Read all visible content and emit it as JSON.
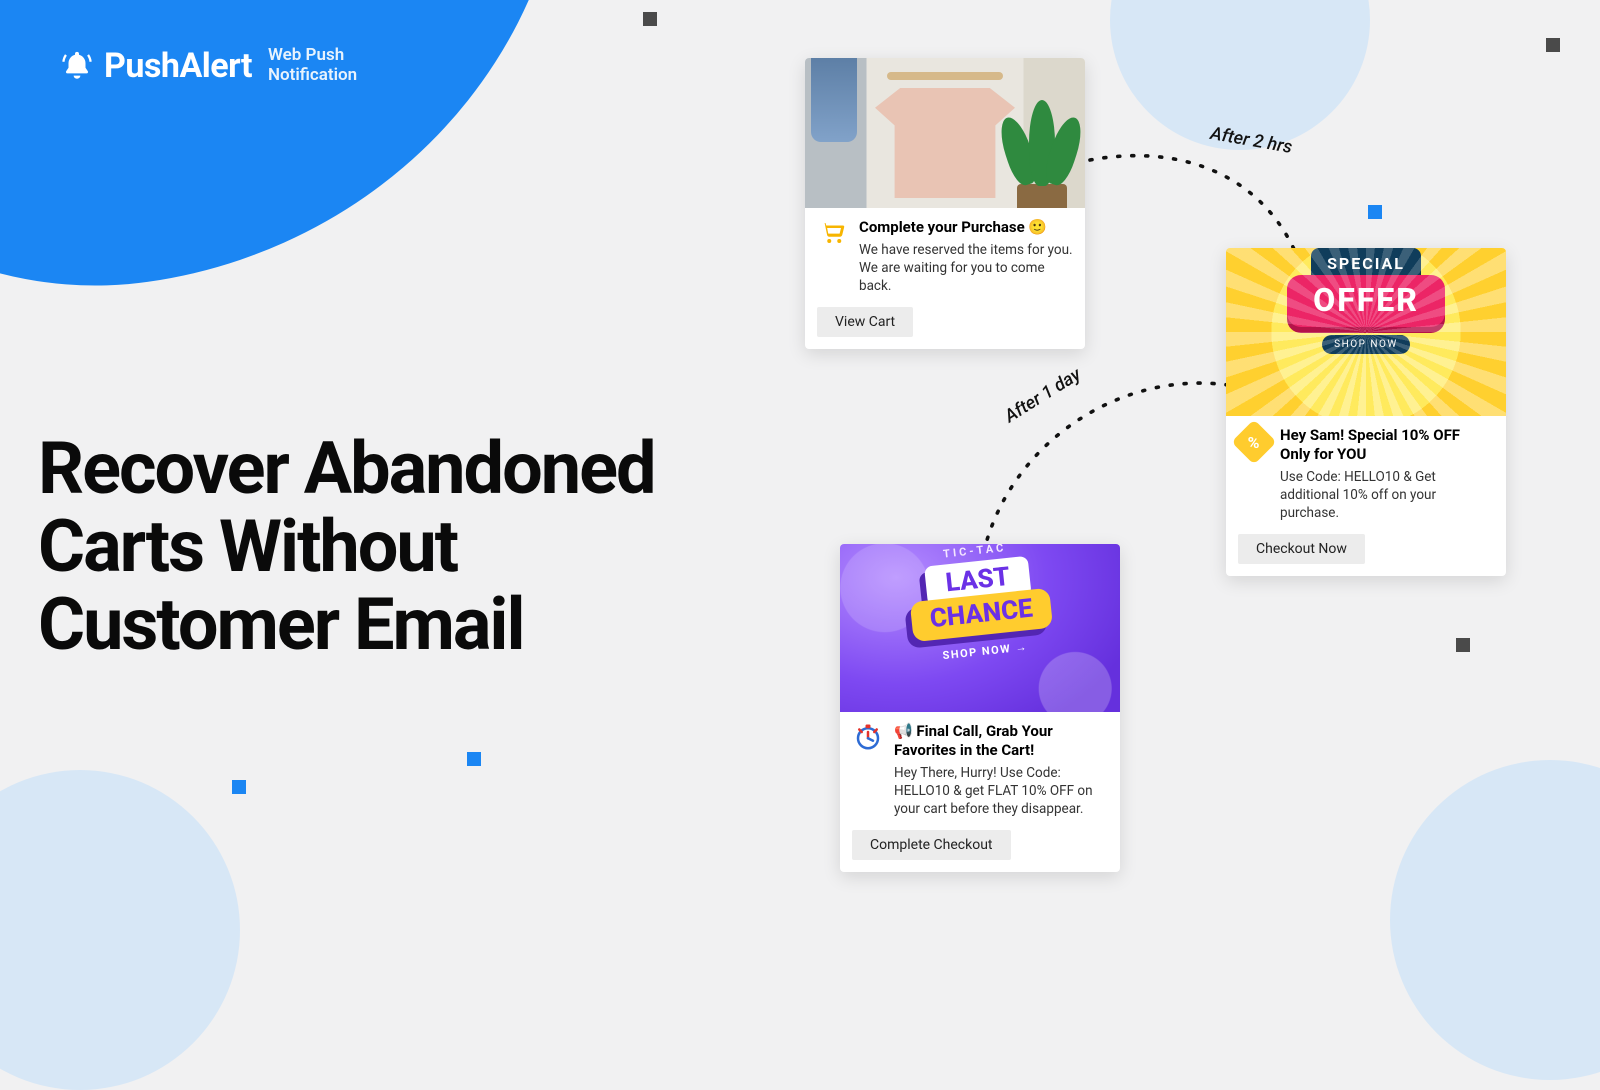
{
  "brand": {
    "name": "PushAlert",
    "subtitle": "Web Push\nNotification"
  },
  "headline": "Recover Abandoned Carts Without Customer Email",
  "connectors": {
    "first": "After 2 hrs",
    "second": "After 1 day"
  },
  "cards": [
    {
      "title": "Complete your Purchase  🙂",
      "desc": "We have reserved the items for you. We are waiting for you to come back.",
      "button": "View Cart"
    },
    {
      "title": "Hey Sam! Special 10% OFF Only for YOU",
      "desc": "Use Code: HELLO10 & Get additional 10% off on your purchase.",
      "button": "Checkout Now",
      "badge_top": "SPECIAL",
      "badge_main": "OFFER",
      "badge_cta": "SHOP NOW"
    },
    {
      "title": "📢 Final Call, Grab Your Favorites in the Cart!",
      "desc": "Hey There, Hurry! Use Code: HELLO10 & get FLAT 10% OFF on your cart before they disappear.",
      "button": "Complete Checkout",
      "band_pre": "TIC-TAC",
      "band_top": "LAST",
      "band_bot": "CHANCE",
      "band_cta": "SHOP NOW  →"
    }
  ]
}
